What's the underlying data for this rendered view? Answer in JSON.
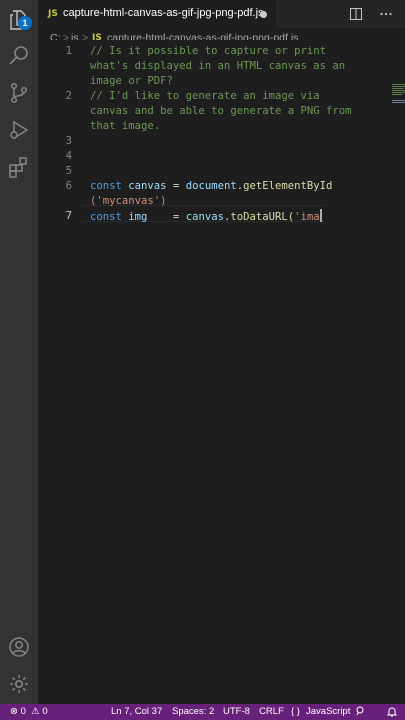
{
  "tab": {
    "icon": "JS",
    "title": "capture-html-canvas-as-gif-jpg-png-pdf.js"
  },
  "explorer_badge": "1",
  "breadcrumb": {
    "drive": "C:",
    "sep": ">",
    "folder": "js",
    "file_icon": "JS",
    "file": "capture-html-canvas-as-gif-jpg-png-pdf.js"
  },
  "lines": [
    {
      "n": "1",
      "text": "// Is it possible to capture or print"
    },
    {
      "n": "",
      "text": "what's displayed in an HTML canvas as an"
    },
    {
      "n": "",
      "text": "image or PDF?"
    },
    {
      "n": "2",
      "text": "// I'd like to generate an image via"
    },
    {
      "n": "",
      "text": "canvas and be able to generate a PNG from"
    },
    {
      "n": "",
      "text": "that image."
    },
    {
      "n": "3",
      "text": ""
    },
    {
      "n": "4",
      "text": ""
    },
    {
      "n": "5",
      "text": ""
    },
    {
      "n": "6",
      "kw": "const ",
      "var": "canvas",
      "op": " = ",
      "obj": "document",
      "dot": ".",
      "fn": "getElementById"
    },
    {
      "n": "",
      "str": "('mycanvas')"
    },
    {
      "n": "7",
      "kw": "const ",
      "var": "img",
      "op": "    = ",
      "obj": "canvas",
      "dot": ".",
      "fn": "toDataURL",
      "paren": "(",
      "str": "'ima"
    }
  ],
  "status": {
    "errors": "0",
    "warnings": "0",
    "position": "Ln 7, Col 37",
    "spaces": "Spaces: 2",
    "encoding": "UTF-8",
    "eol": "CRLF",
    "braces": "{ }",
    "language": "JavaScript"
  },
  "colors": {
    "statusbar": "#68217a",
    "activity_bar": "#333333",
    "editor_bg": "#1e1e1e"
  }
}
